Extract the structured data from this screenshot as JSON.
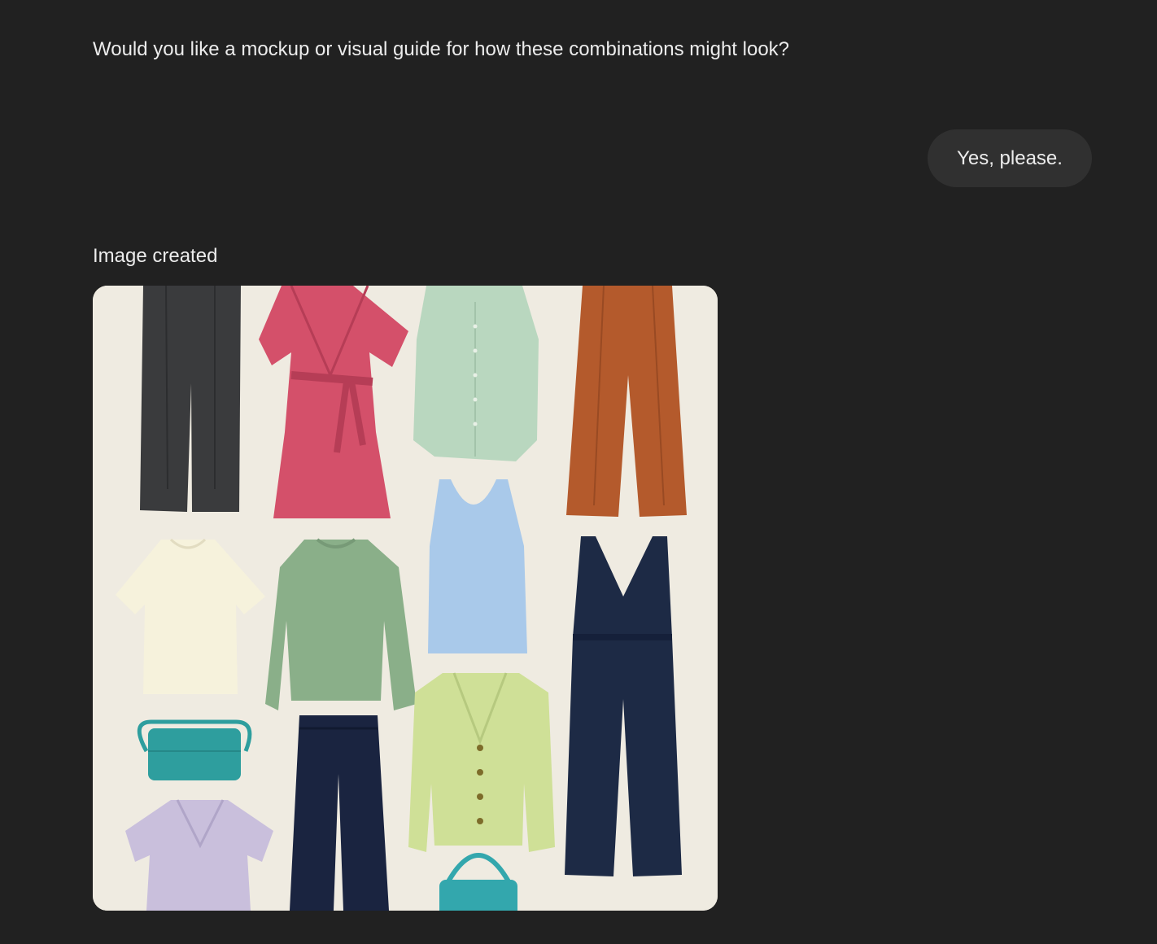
{
  "conversation": {
    "assistant_message": "Would you like a mockup or visual guide for how these combinations might look?",
    "user_message": "Yes, please.",
    "image_status": "Image created"
  },
  "image": {
    "background_color": "#efebe1",
    "items": [
      {
        "kind": "trousers",
        "color": "#3a3b3d"
      },
      {
        "kind": "wrap-dress",
        "color": "#d4506a"
      },
      {
        "kind": "sleeveless-shirt",
        "color": "#b9d7bf"
      },
      {
        "kind": "wide-trousers",
        "color": "#b45a2c"
      },
      {
        "kind": "t-shirt",
        "color": "#f6f2dc"
      },
      {
        "kind": "sweater",
        "color": "#8aaf89"
      },
      {
        "kind": "tank-top",
        "color": "#a9c9ea"
      },
      {
        "kind": "jumpsuit",
        "color": "#1d2a45"
      },
      {
        "kind": "crossbody-bag",
        "color": "#2e9e9e"
      },
      {
        "kind": "cropped-trousers",
        "color": "#1a2440"
      },
      {
        "kind": "cardigan",
        "color": "#cfe097"
      },
      {
        "kind": "floral-dress",
        "color": "#c9bfdc"
      },
      {
        "kind": "handbag",
        "color": "#33a7ad"
      }
    ]
  }
}
